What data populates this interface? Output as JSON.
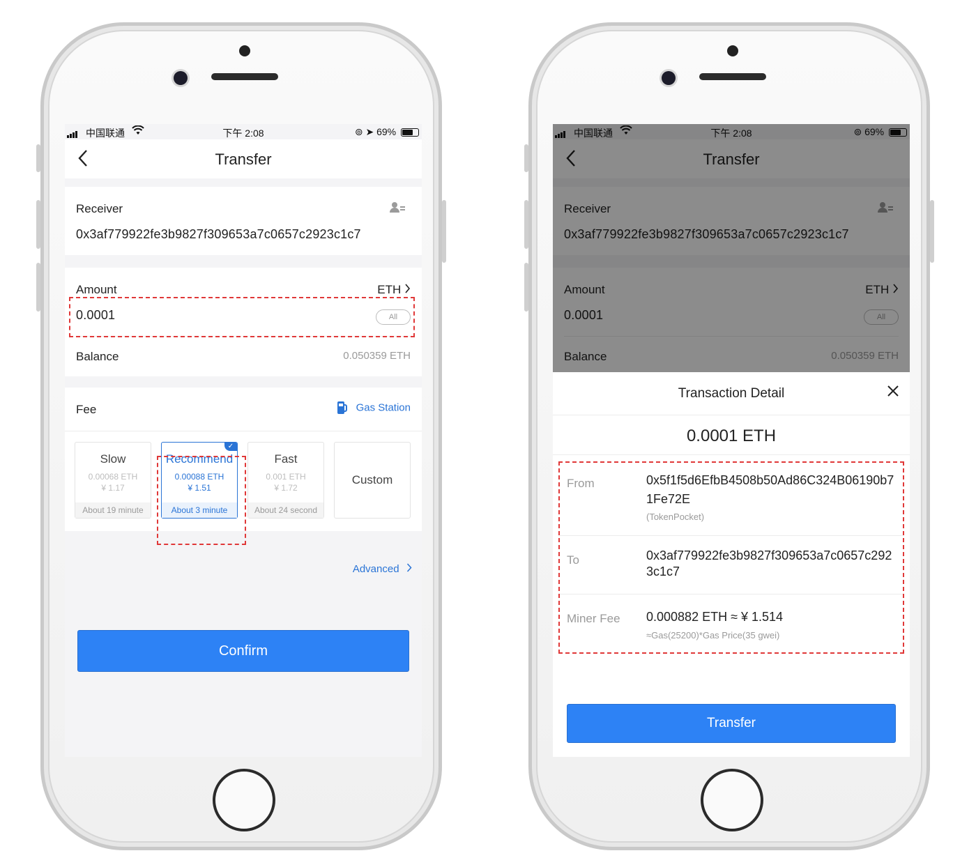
{
  "status_bar": {
    "carrier": "中国联通",
    "time": "下午 2:08",
    "battery": "69%",
    "battery_level": 0.69
  },
  "left_screen": {
    "nav_title": "Transfer",
    "receiver_label": "Receiver",
    "receiver_address": "0x3af779922fe3b9827f309653a7c0657c2923c1c7",
    "amount_label": "Amount",
    "token": "ETH",
    "amount_value": "0.0001",
    "all_label": "All",
    "balance_label": "Balance",
    "balance_value": "0.050359 ETH",
    "fee_label": "Fee",
    "gas_station_label": "Gas Station",
    "speeds": [
      {
        "name": "Slow",
        "eth": "0.00068 ETH",
        "cny": "¥ 1.17",
        "time": "About 19 minute"
      },
      {
        "name": "Recommend",
        "eth": "0.00088 ETH",
        "cny": "¥ 1.51",
        "time": "About 3 minute"
      },
      {
        "name": "Fast",
        "eth": "0.001 ETH",
        "cny": "¥ 1.72",
        "time": "About 24 second"
      },
      {
        "name": "Custom"
      }
    ],
    "selected_speed": "Recommend",
    "advanced_label": "Advanced",
    "confirm_label": "Confirm"
  },
  "right_screen": {
    "nav_title": "Transfer",
    "receiver_label": "Receiver",
    "receiver_address": "0x3af779922fe3b9827f309653a7c0657c2923c1c7",
    "amount_label": "Amount",
    "token": "ETH",
    "amount_value": "0.0001",
    "all_label": "All",
    "balance_label": "Balance",
    "balance_value": "0.050359 ETH",
    "detail_title": "Transaction Detail",
    "detail_amount": "0.0001 ETH",
    "from_label": "From",
    "from_address": "0x5f1f5d6EfbB4508b50Ad86C324B06190b71Fe72E",
    "from_wallet": "(TokenPocket)",
    "to_label": "To",
    "to_address": "0x3af779922fe3b9827f309653a7c0657c2923c1c7",
    "miner_fee_label": "Miner Fee",
    "miner_fee_value": "0.000882 ETH ≈ ¥ 1.514",
    "miner_fee_formula": "≈Gas(25200)*Gas Price(35 gwei)",
    "transfer_label": "Transfer"
  },
  "colors": {
    "accent": "#2d82f5",
    "link": "#2a74d6",
    "highlight": "#e03838",
    "overlay": "rgba(0,0,0,0.45)"
  },
  "icons": [
    "back-chevron-icon",
    "contact-book-icon",
    "gas-pump-icon",
    "chevron-right-icon",
    "close-icon",
    "wifi-icon",
    "signal-icon",
    "battery-icon",
    "location-arrow-icon",
    "rotation-lock-icon",
    "check-icon"
  ]
}
